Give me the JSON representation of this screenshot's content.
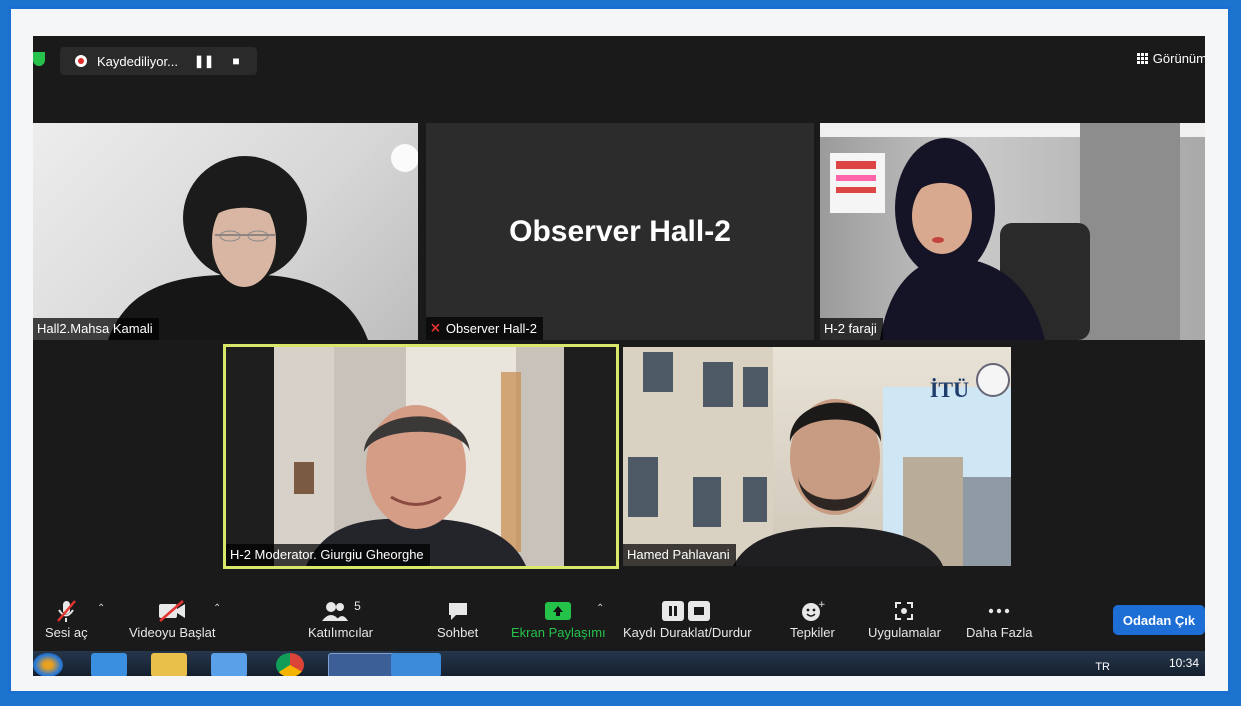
{
  "recording": {
    "status_label": "Kaydediliyor...",
    "pause_glyph": "❚❚",
    "stop_glyph": "■"
  },
  "view_button_label": "Görünüm",
  "participants": [
    {
      "name": "Hall2.Mahsa Kamali"
    },
    {
      "name": "Observer Hall-2",
      "display_title": "Observer Hall-2",
      "muted": true
    },
    {
      "name": "H-2 faraji"
    },
    {
      "name": "H-2 Moderator. Giurgiu Gheorghe",
      "active_speaker": true
    },
    {
      "name": "Hamed Pahlavani",
      "overlay_logo": "İTÜ"
    }
  ],
  "toolbar": {
    "unmute_label": "Sesi aç",
    "start_video_label": "Videoyu Başlat",
    "participants_label": "Katılımcılar",
    "participants_count": "5",
    "chat_label": "Sohbet",
    "share_screen_label": "Ekran Paylaşımı",
    "pause_stop_recording_label": "Kaydı Duraklat/Durdur",
    "reactions_label": "Tepkiler",
    "apps_label": "Uygulamalar",
    "more_label": "Daha Fazla",
    "leave_label": "Odadan Çık"
  },
  "taskbar": {
    "language": "TR",
    "clock": "10:34"
  },
  "colors": {
    "active_speaker_border": "#d9e86a",
    "share_green": "#25c24a",
    "leave_blue": "#1d6fd6",
    "frame_blue": "#1c74cf"
  }
}
